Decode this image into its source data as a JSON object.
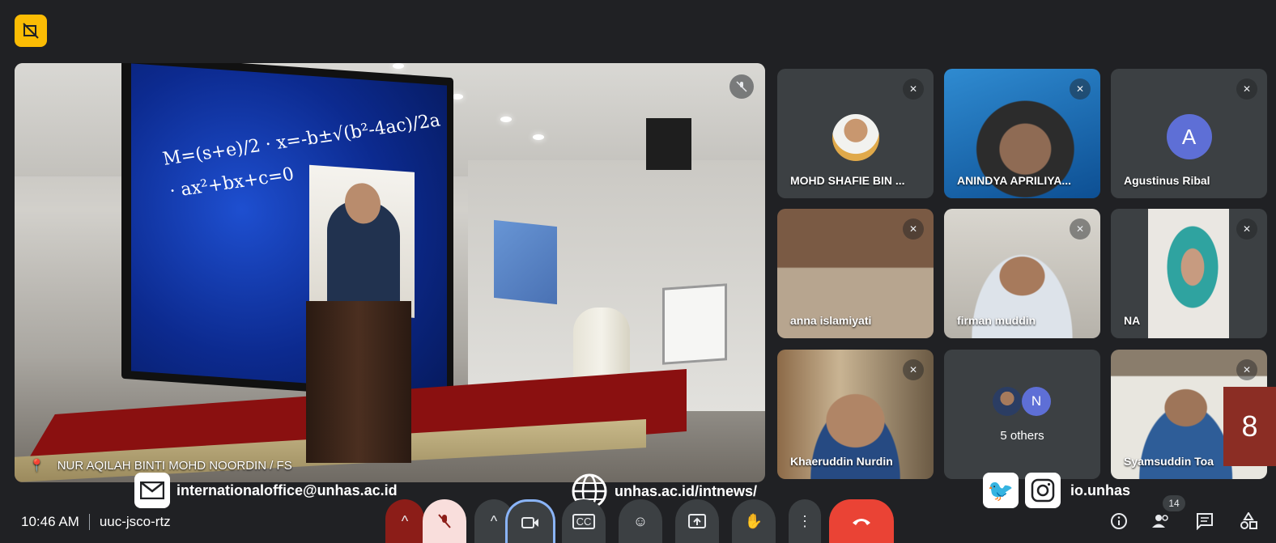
{
  "meeting": {
    "time": "10:46 AM",
    "code": "uuc-jsco-rtz"
  },
  "main_speaker": {
    "name": "NUR AQILAH BINTI MOHD NOORDIN / FS"
  },
  "participants": [
    {
      "name": "MOHD SHAFIE BIN ...",
      "muted": true
    },
    {
      "name": "ANINDYA APRILIYA...",
      "muted": true
    },
    {
      "name": "Agustinus Ribal",
      "muted": true,
      "avatar_letter": "A"
    },
    {
      "name": "anna islamiyati",
      "muted": true
    },
    {
      "name": "firman muddin",
      "muted": true
    },
    {
      "name": "NA",
      "muted": true
    },
    {
      "name": "Khaeruddin Nurdin",
      "muted": true
    },
    {
      "name": "5 others",
      "avatar_letter": "N"
    },
    {
      "name": "Syamsuddin Toa",
      "muted": true
    }
  ],
  "slide": {
    "formula": "M=(s+e)/2 · x=-b±√(b²-4ac)/2a · ax²+bx+c=0",
    "page_number": "8"
  },
  "contacts": {
    "email": "internationaloffice@unhas.ac.id",
    "website": "unhas.ac.id/intnews/",
    "social": "io.unhas"
  },
  "people_count": "14",
  "colors": {
    "accent_red": "#ea4335",
    "recording": "#fbbc04",
    "page_badge": "#8b2d24"
  }
}
